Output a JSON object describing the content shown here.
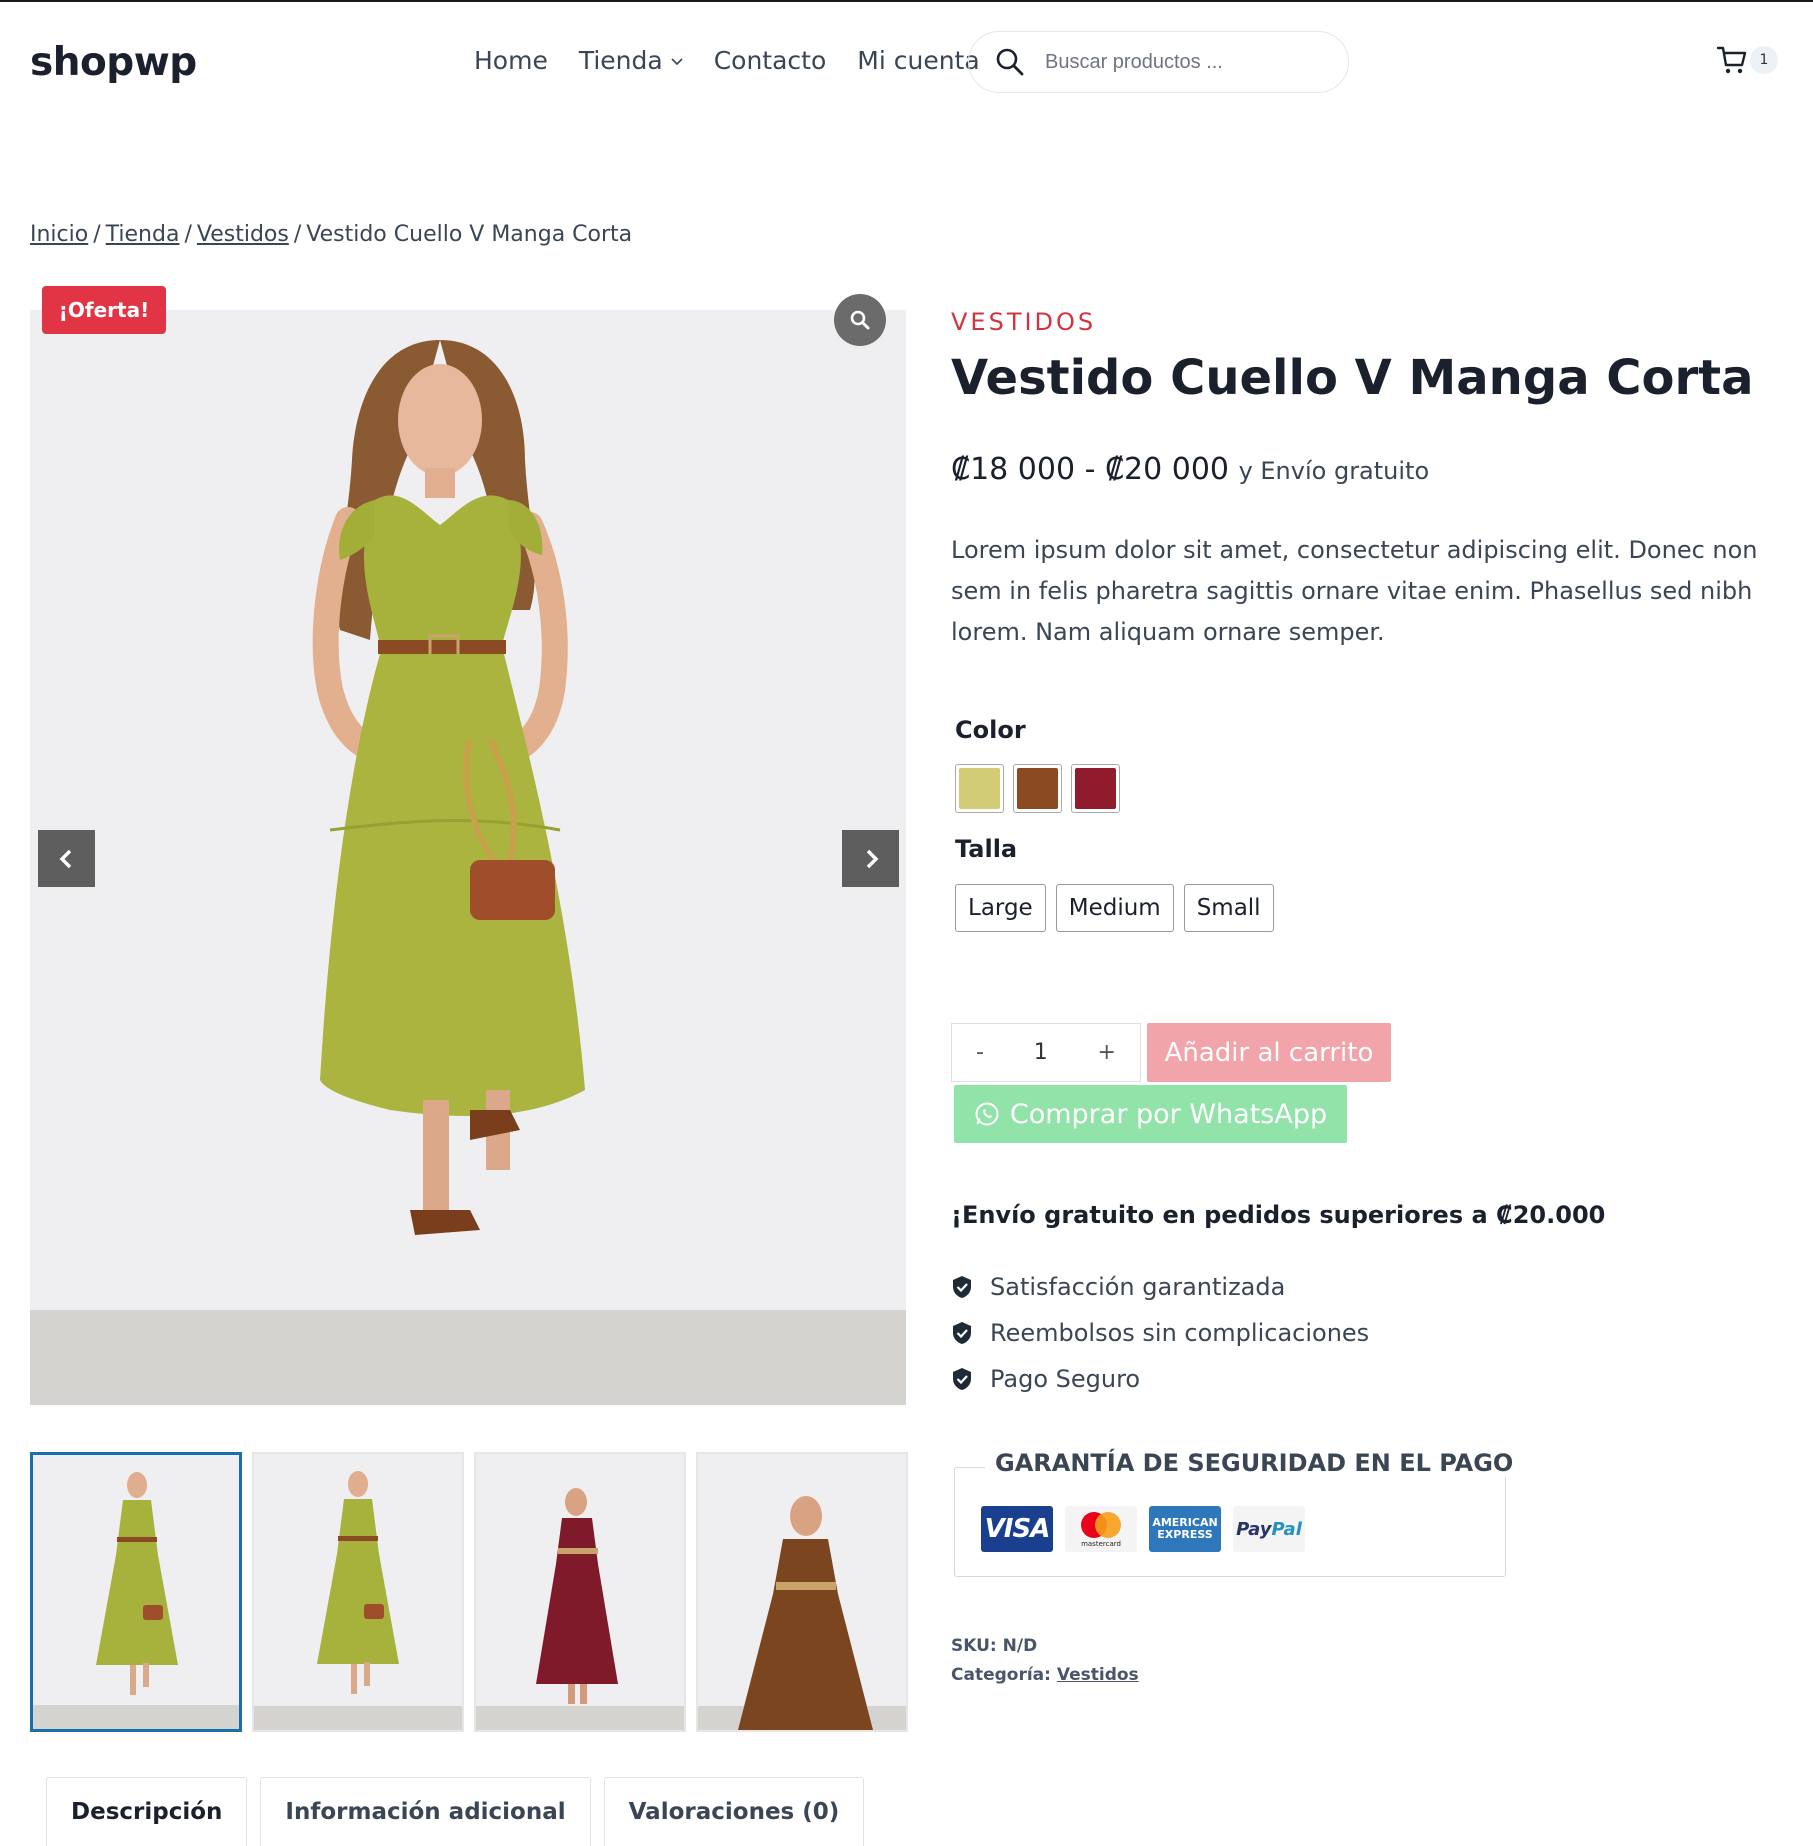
{
  "header": {
    "logo": "shopwp",
    "nav": [
      {
        "label": "Home"
      },
      {
        "label": "Tienda",
        "has_dropdown": true
      },
      {
        "label": "Contacto"
      },
      {
        "label": "Mi cuenta"
      }
    ],
    "search": {
      "placeholder": "Buscar productos ..."
    },
    "cart_count": "1"
  },
  "breadcrumb": {
    "items": [
      "Inicio",
      "Tienda",
      "Vestidos"
    ],
    "current": "Vestido Cuello V Manga Corta",
    "separator": "/"
  },
  "gallery": {
    "sale_badge": "¡Oferta!",
    "thumbnails": [
      {
        "dress_color": "#a8b53f",
        "active": true
      },
      {
        "dress_color": "#a8b53f",
        "active": false
      },
      {
        "dress_color": "#7e1a2a",
        "active": false
      },
      {
        "dress_color": "#7b451f",
        "active": false
      }
    ]
  },
  "product": {
    "category": "VESTIDOS",
    "title": "Vestido Cuello V Manga Corta",
    "price": "₡18 000 - ₡20 000",
    "shipping": "y Envío gratuito",
    "description": "Lorem ipsum dolor sit amet, consectetur adipiscing elit. Donec non sem in felis pharetra sagittis ornare vitae enim. Phasellus sed nibh lorem. Nam aliquam ornare semper.",
    "color_label": "Color",
    "colors": [
      "#d2cc77",
      "#8b4a22",
      "#8f1b2d"
    ],
    "size_label": "Talla",
    "sizes": [
      "Large",
      "Medium",
      "Small"
    ],
    "quantity": {
      "minus": "-",
      "value": "1",
      "plus": "+"
    },
    "add_to_cart": "Añadir al carrito",
    "whatsapp": "Comprar por WhatsApp",
    "free_shipping_note": "¡Envío gratuito en pedidos superiores a ₡20.000",
    "perks": [
      "Satisfacción garantizada",
      "Reembolsos sin complicaciones",
      "Pago Seguro"
    ],
    "guarantee_title": "GARANTÍA DE SEGURIDAD EN EL PAGO",
    "cards": {
      "visa": "VISA",
      "mastercard": "mastercard",
      "amex_line1": "AMERICAN",
      "amex_line2": "EXPRESS",
      "paypal_a": "Pay",
      "paypal_b": "Pal"
    },
    "sku_label": "SKU:",
    "sku_value": "N/D",
    "category_meta_label": "Categoría:",
    "category_meta_value": "Vestidos"
  },
  "tabs": [
    {
      "label": "Descripción",
      "active": true
    },
    {
      "label": "Información adicional",
      "active": false
    },
    {
      "label": "Valoraciones (0)",
      "active": false
    }
  ],
  "colors": {
    "accent_red": "#e13444",
    "category_red": "#d2343f",
    "add_to_cart_bg": "#f2a4ab",
    "whatsapp_bg": "#92e3a9",
    "thumb_active_border": "#1b6fa8"
  }
}
